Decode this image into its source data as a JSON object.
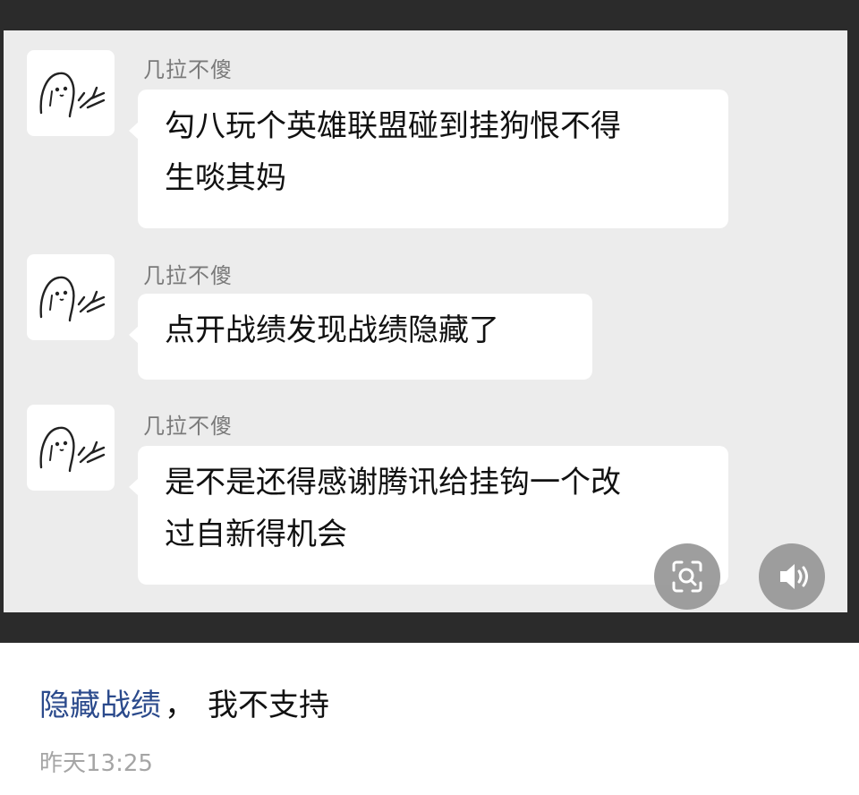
{
  "messages": [
    {
      "sender": "几拉不傻",
      "lines": [
        "勾八玩个英雄联盟碰到挂狗恨不得",
        "生啖其妈"
      ]
    },
    {
      "sender": "几拉不傻",
      "lines": [
        "点开战绩发现战绩隐藏了"
      ]
    },
    {
      "sender": "几拉不傻",
      "lines": [
        "是不是还得感谢腾讯给挂钩一个改",
        "过自新得机会"
      ]
    }
  ],
  "overlay_buttons": [
    {
      "icon": "image-search-icon"
    },
    {
      "icon": "speaker-icon"
    }
  ],
  "post": {
    "topic": "隐藏战绩",
    "separator": "，",
    "text": "我不支持",
    "timestamp": "昨天13:25"
  },
  "colors": {
    "topic_link": "#2b4a8c",
    "chat_background": "#ececec",
    "bubble": "#ffffff",
    "frame": "#2b2b2b"
  }
}
